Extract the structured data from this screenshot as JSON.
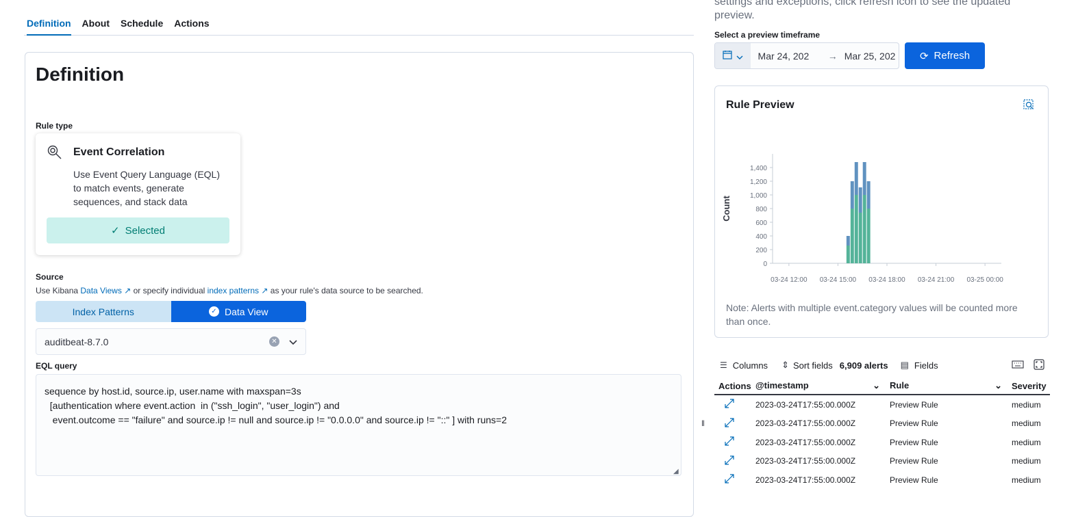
{
  "tabs": [
    {
      "label": "Definition",
      "active": true
    },
    {
      "label": "About"
    },
    {
      "label": "Schedule"
    },
    {
      "label": "Actions"
    }
  ],
  "definition": {
    "title": "Definition",
    "rule_type_label": "Rule type",
    "card": {
      "title": "Event Correlation",
      "description": [
        "Use Event Query Language (EQL)",
        "to match events, generate",
        "sequences, and stack data"
      ],
      "selected_label": "Selected"
    },
    "source": {
      "label": "Source",
      "prefix": "Use Kibana ",
      "link1": "Data Views",
      "mid": " or specify individual ",
      "link2": "index patterns",
      "suffix": " as your rule's data source to be searched."
    },
    "toggle": {
      "option1": "Index Patterns",
      "option2": "Data View",
      "selected": "Data View"
    },
    "data_view_value": "auditbeat-8.7.0",
    "eql_label": "EQL query",
    "eql_query": "sequence by host.id, source.ip, user.name with maxspan=3s\n  [authentication where event.action  in (\"ssh_login\", \"user_login\") and\n   event.outcome == \"failure\" and source.ip != null and source.ip != \"0.0.0.0\" and source.ip != \"::\" ] with runs=2"
  },
  "preview": {
    "intro_text": [
      "settings and exceptions, click refresh icon to see the updated",
      "preview."
    ],
    "timeframe_label": "Select a preview timeframe",
    "start_date": "Mar 24, 202",
    "end_date": "Mar 25, 202",
    "refresh_label": "Refresh",
    "title": "Rule Preview",
    "note": [
      "Note: Alerts with multiple event.category values will be counted more",
      "than once."
    ]
  },
  "chart_data": {
    "type": "bar",
    "stacked": true,
    "ylabel": "Count",
    "xlabel": "",
    "x_ticks": [
      "03-24 12:00",
      "03-24 15:00",
      "03-24 18:00",
      "03-24 21:00",
      "03-25 00:00"
    ],
    "y_ticks": [
      "0",
      "200",
      "400",
      "600",
      "800",
      "1,000",
      "1,200",
      "1,400"
    ],
    "ylim": [
      0,
      1500
    ],
    "categories": [
      "03-24 15:45",
      "03-24 16:00",
      "03-24 16:15",
      "03-24 16:30",
      "03-24 16:45",
      "03-24 17:00",
      "03-24 17:15"
    ],
    "series": [
      {
        "color": "#54b399",
        "values": [
          260,
          800,
          1000,
          740,
          1000,
          800,
          0
        ]
      },
      {
        "color": "#6092c0",
        "values": [
          140,
          400,
          480,
          370,
          480,
          400,
          0
        ]
      }
    ],
    "colors": {
      "bottom": "#54b399",
      "top": "#6092c0"
    }
  },
  "table": {
    "columns_label": "Columns",
    "sort_label": "Sort fields",
    "count": "6,909 alerts",
    "fields_label": "Fields",
    "headers": [
      "Actions",
      "@timestamp",
      "Rule",
      "Severity"
    ],
    "rows": [
      {
        "timestamp": "2023-03-24T17:55:00.000Z",
        "rule": "Preview Rule",
        "severity": "medium"
      },
      {
        "timestamp": "2023-03-24T17:55:00.000Z",
        "rule": "Preview Rule",
        "severity": "medium"
      },
      {
        "timestamp": "2023-03-24T17:55:00.000Z",
        "rule": "Preview Rule",
        "severity": "medium"
      },
      {
        "timestamp": "2023-03-24T17:55:00.000Z",
        "rule": "Preview Rule",
        "severity": "medium"
      },
      {
        "timestamp": "2023-03-24T17:55:00.000Z",
        "rule": "Preview Rule",
        "severity": "medium"
      }
    ]
  }
}
